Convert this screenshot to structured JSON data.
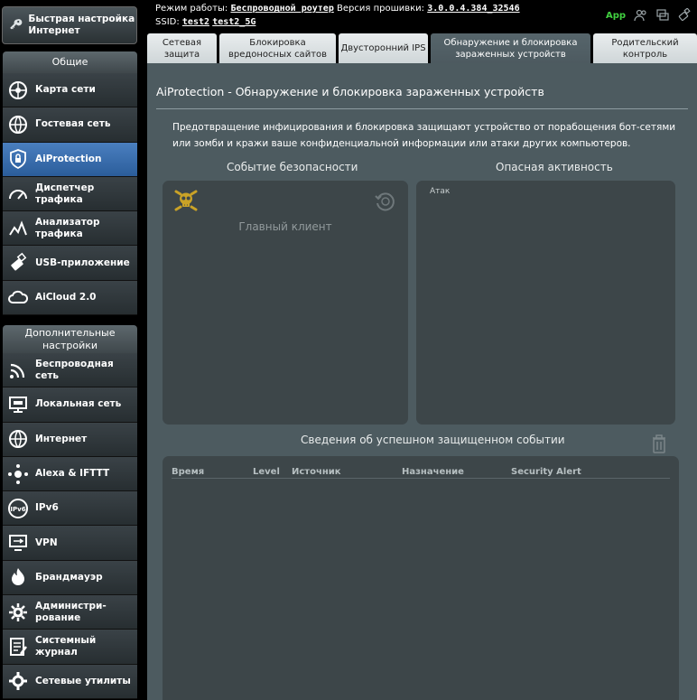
{
  "sidebar": {
    "quick": {
      "label": "Быстрая настройка Интернет"
    },
    "general_header": "Общие",
    "general_items": [
      {
        "label": "Карта сети",
        "icon": "network-map-icon"
      },
      {
        "label": "Гостевая сеть",
        "icon": "guest-network-icon"
      },
      {
        "label": "AiProtection",
        "icon": "aiprotection-lock-icon",
        "active": true
      },
      {
        "label": "Диспетчер трафика",
        "icon": "speedometer-icon"
      },
      {
        "label": "Анализатор трафика",
        "icon": "traffic-analyzer-icon"
      },
      {
        "label": "USB-приложение",
        "icon": "usb-icon"
      },
      {
        "label": "AiCloud 2.0",
        "icon": "cloud-icon"
      }
    ],
    "advanced_header": "Дополнительные настройки",
    "advanced_items": [
      {
        "label": "Беспроводная сеть",
        "icon": "wifi-icon"
      },
      {
        "label": "Локальная сеть",
        "icon": "lan-icon"
      },
      {
        "label": "Интернет",
        "icon": "globe-icon"
      },
      {
        "label": "Alexa & IFTTT",
        "icon": "alexa-icon"
      },
      {
        "label": "IPv6",
        "icon": "ipv6-icon"
      },
      {
        "label": "VPN",
        "icon": "vpn-icon"
      },
      {
        "label": "Брандмауэр",
        "icon": "firewall-icon"
      },
      {
        "label": "Администри-рование",
        "icon": "admin-gear-icon"
      },
      {
        "label": "Системный журнал",
        "icon": "system-log-icon"
      },
      {
        "label": "Сетевые утилиты",
        "icon": "network-tools-icon"
      }
    ]
  },
  "header": {
    "mode_label": "Режим работы:",
    "mode_value": "Беспроводной роутер",
    "firmware_label": "Версия прошивки:",
    "firmware_value": "3.0.0.4.384_32546",
    "ssid_label": "SSID:",
    "ssid_1": "test2",
    "ssid_2": "test2_5G",
    "app_label": "App"
  },
  "tabs": [
    {
      "label": "Сетевая защита"
    },
    {
      "label": "Блокировка вредоносных сайтов"
    },
    {
      "label": "Двусторонний IPS"
    },
    {
      "label": "Обнаружение и блокировка зараженных устройств",
      "active": true
    },
    {
      "label": "Родительский контроль"
    }
  ],
  "main": {
    "title": "AiProtection - Обнаружение и блокировка зараженных устройств",
    "description": "Предотвращение инфицирования и блокировка защищают устройство от порабощения бот-сетями или зомби и кражи ваше конфиденциальной информации или атаки других компьютеров.",
    "security_event_title": "Событие безопасности",
    "threat_activity_title": "Опасная активность",
    "main_client": "Главный клиент",
    "attack_label": "Атак",
    "events_title": "Сведения об успешном защищенном событии",
    "table_headers": [
      "Время",
      "Level",
      "Источник",
      "Назначение",
      "Security Alert"
    ]
  },
  "colors": {
    "panel": "#4d5b60",
    "box": "#3d4649",
    "active_menu": "#3a6fae",
    "app_green": "#41d140",
    "skull": "#c9a227"
  }
}
